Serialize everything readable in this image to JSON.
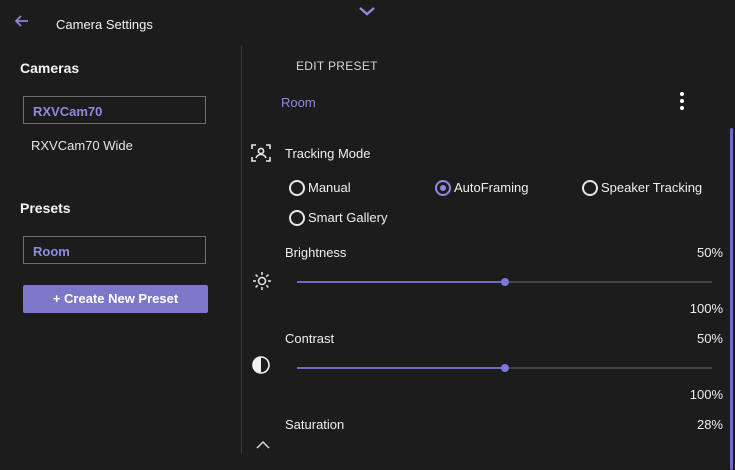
{
  "header": {
    "title": "Camera Settings"
  },
  "left": {
    "cameras_heading": "Cameras",
    "cameras": [
      {
        "label": "RXVCam70",
        "selected": true
      },
      {
        "label": "RXVCam70 Wide",
        "selected": false
      }
    ],
    "presets_heading": "Presets",
    "preset_selected": "Room",
    "create_button": "+ Create New Preset"
  },
  "edit": {
    "heading": "EDIT PRESET",
    "preset_name": "Room",
    "tracking": {
      "label": "Tracking Mode",
      "options": [
        {
          "label": "Manual",
          "selected": false
        },
        {
          "label": "AutoFraming",
          "selected": true
        },
        {
          "label": "Speaker Tracking",
          "selected": false
        },
        {
          "label": "Smart Gallery",
          "selected": false
        }
      ]
    },
    "brightness": {
      "label": "Brightness",
      "value": "50%",
      "max": "100%",
      "level": 0.5
    },
    "contrast": {
      "label": "Contrast",
      "value": "50%",
      "max": "100%",
      "level": 0.5
    },
    "saturation": {
      "label": "Saturation",
      "value": "28%"
    }
  },
  "colors": {
    "accent": "#8f8ae0",
    "button": "#7d77c9",
    "background": "#1c1c1c"
  }
}
